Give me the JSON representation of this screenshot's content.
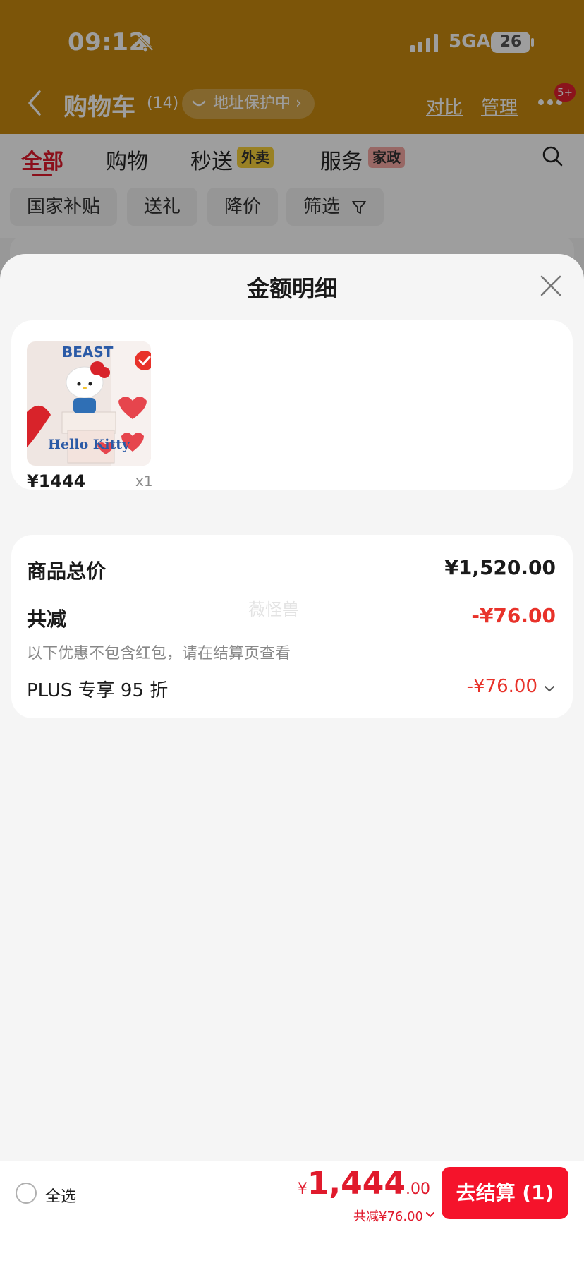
{
  "status_bar": {
    "time": "09:12",
    "network": "5GA",
    "battery": "26"
  },
  "nav": {
    "title": "购物车",
    "count": "(14)",
    "address_pill": "地址保护中 ›",
    "compare": "对比",
    "manage": "管理",
    "badge": "5+"
  },
  "tabs": [
    {
      "label": "全部",
      "active": true
    },
    {
      "label": "购物",
      "active": false
    },
    {
      "label": "秒送",
      "badge": "外卖"
    },
    {
      "label": "服务",
      "badge": "家政"
    }
  ],
  "chips": [
    "国家补贴",
    "送礼",
    "降价",
    "筛选"
  ],
  "sheet": {
    "title": "金额明细",
    "product": {
      "price": "¥1444",
      "qty": "x1",
      "image_text_top": "BEAST",
      "image_text_bottom": "Hello Kitty"
    },
    "summary": {
      "total_label": "商品总价",
      "total_value": "¥1,520.00",
      "discount_label": "共减",
      "discount_value": "-¥76.00",
      "note": "以下优惠不包含红包，请在结算页查看",
      "plus_label": "PLUS 专享 95 折",
      "plus_value": "-¥76.00",
      "watermark": "薇怪兽"
    }
  },
  "bottom": {
    "select_all": "全选",
    "currency": "¥",
    "total_int": "1,444",
    "total_dec": ".00",
    "discount": "共减¥76.00",
    "checkout": "去结算 (1)"
  },
  "colors": {
    "accent_red": "#e01a2c",
    "header_bg": "#c88a0f"
  }
}
